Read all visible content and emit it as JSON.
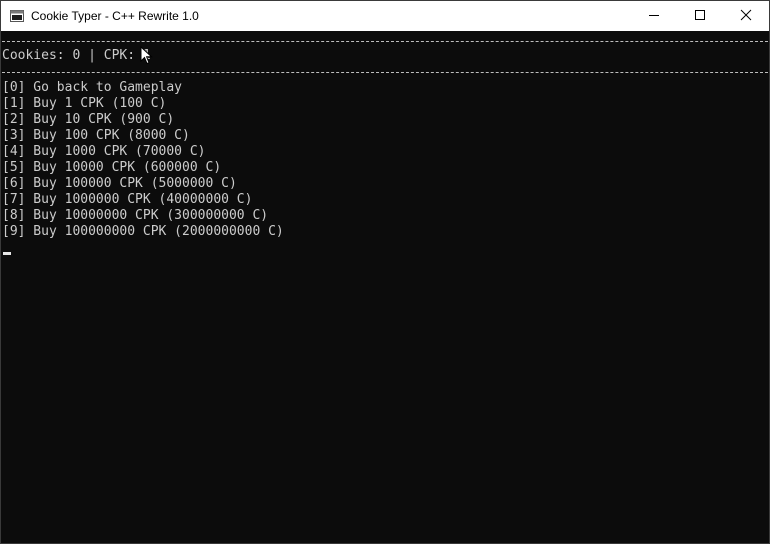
{
  "window": {
    "title": "Cookie Typer - C++ Rewrite 1.0",
    "icons": {
      "app": "console-app-icon",
      "minimize": "minimize-icon",
      "maximize": "maximize-icon",
      "close": "close-icon"
    }
  },
  "console": {
    "status_line": "Cookies: 0 | CPK: 1",
    "menu": [
      "[0] Go back to Gameplay",
      "[1] Buy 1 CPK (100 C)",
      "[2] Buy 10 CPK (900 C)",
      "[3] Buy 100 CPK (8000 C)",
      "[4] Buy 1000 CPK (70000 C)",
      "[5] Buy 10000 CPK (600000 C)",
      "[6] Buy 100000 CPK (5000000 C)",
      "[7] Buy 1000000 CPK (40000000 C)",
      "[8] Buy 10000000 CPK (300000000 C)",
      "[9] Buy 100000000 CPK (2000000000 C)"
    ]
  },
  "colors": {
    "console_background": "#0c0c0c",
    "console_text": "#cccccc",
    "titlebar_background": "#ffffff"
  }
}
